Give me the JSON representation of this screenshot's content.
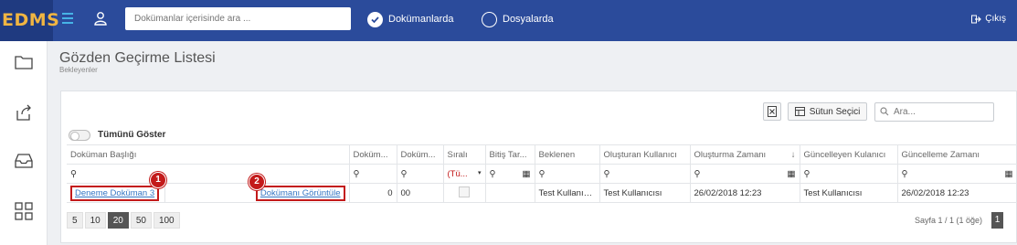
{
  "app": {
    "logo": "EDMS"
  },
  "header": {
    "search_placeholder": "Dokümanlar içerisinde ara ...",
    "scope_options": [
      {
        "label": "Dokümanlarda",
        "selected": true
      },
      {
        "label": "Dosyalarda",
        "selected": false
      }
    ],
    "logout_label": "Çıkış"
  },
  "sidebar": {
    "items": [
      {
        "icon": "folder-icon"
      },
      {
        "icon": "share-icon"
      },
      {
        "icon": "inbox-icon"
      },
      {
        "icon": "apps-grid-icon"
      }
    ]
  },
  "page": {
    "title": "Gözden Geçirme Listesi",
    "subtitle": "Bekleyenler"
  },
  "toolbar": {
    "column_chooser_label": "Sütun Seçici",
    "search_placeholder": "Ara...",
    "show_all_label": "Tümünü Göster"
  },
  "table": {
    "columns": [
      "Doküman Başlığı",
      "",
      "Doküm...",
      "Doküm...",
      "Sıralı",
      "Bitiş Tar...",
      "Beklenen",
      "Oluşturan Kullanıcı",
      "Oluşturma Zamanı",
      "Güncelleyen Kulanıcı",
      "Güncelleme Zamanı"
    ],
    "filter_select_value": "(Tü...",
    "rows": [
      {
        "title": "Deneme Doküman 3",
        "action": "Dokümanı Görüntüle",
        "c3": "0",
        "c4": "00",
        "c6": "",
        "c7": "Test Kullanıcısı",
        "c8": "Test Kullanıcısı",
        "c9": "26/02/2018 12:23",
        "c10": "Test Kullanıcısı",
        "c11": "26/02/2018 12:23"
      }
    ]
  },
  "annotations": [
    {
      "label": "1"
    },
    {
      "label": "2"
    }
  ],
  "pager": {
    "sizes": [
      "5",
      "10",
      "20",
      "50",
      "100"
    ],
    "active_size": "20",
    "info": "Sayfa 1 / 1 (1 öğe)",
    "current_page": "1"
  },
  "colors": {
    "topbar": "#2b4b9b",
    "logo_text": "#f0b542",
    "highlight": "#c31a1a",
    "link": "#3576c4"
  }
}
